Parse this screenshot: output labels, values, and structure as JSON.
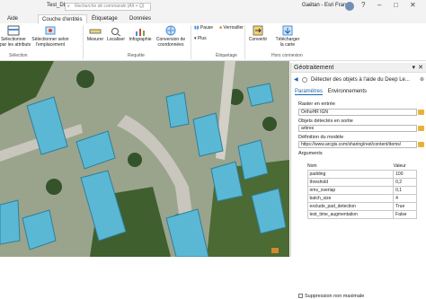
{
  "titlebar": {
    "project": "Test_DL",
    "search_placeholder": "Recherche de commande (Alt + Q)",
    "user": "Gaëtan - Esri France",
    "help": "?",
    "minimize": "–",
    "maximize": "□",
    "close": "✕"
  },
  "tabs": [
    "Aide",
    "Couche d'entités",
    "Étiquetage",
    "Données"
  ],
  "ribbon": {
    "buttons": [
      {
        "label": "Sélectionner\npar les attributs",
        "icon": "select-attributes-icon"
      },
      {
        "label": "Sélectionner selon\nl'emplacement",
        "icon": "select-location-icon"
      },
      {
        "label": "Mesurer",
        "icon": "measure-icon"
      },
      {
        "label": "Localiser",
        "icon": "locate-icon"
      },
      {
        "label": "Infographie",
        "icon": "infographic-icon"
      },
      {
        "label": "Conversion de\ncoordonnées",
        "icon": "coordinate-conversion-icon"
      },
      {
        "label": "Pause",
        "icon": "pause-icon"
      },
      {
        "label": "Verrouiller",
        "icon": "lock-icon"
      },
      {
        "label": "Plus",
        "icon": "more-icon"
      },
      {
        "label": "Convertir",
        "icon": "convert-icon"
      },
      {
        "label": "Télécharger\nla carte",
        "icon": "download-map-icon"
      }
    ],
    "groups": [
      "Sélection",
      "Requête",
      "Étiquetage",
      "Hors connexion"
    ]
  },
  "geoprocessing": {
    "title": "Géotraitement",
    "tool": "Détecter des objets à l'aide du Deep Le...",
    "tabs": [
      "Paramètres",
      "Environnements"
    ],
    "raster_label": "Raster en entrée",
    "raster_value": "OrthoHR IGN",
    "output_label": "Objets détectés en sortie",
    "output_value": "arbres",
    "model_label": "Définition du modèle",
    "model_value": "https://www.arcgis.com/sharing/rest/content/items/",
    "args_label": "Arguments",
    "args_headers": [
      "Nom",
      "Valeur"
    ],
    "args": [
      {
        "name": "padding",
        "value": "100"
      },
      {
        "name": "threshold",
        "value": "0,2"
      },
      {
        "name": "nms_overlap",
        "value": "0,1"
      },
      {
        "name": "batch_size",
        "value": "4"
      },
      {
        "name": "exclude_pad_detection",
        "value": "True"
      },
      {
        "name": "test_time_augmentation",
        "value": "False"
      }
    ],
    "nms_label": "Suppression non maximale"
  },
  "colors": {
    "accent": "#1a64b4",
    "roof": "#5bb8d4",
    "vegetation": "#3c5a2a"
  }
}
